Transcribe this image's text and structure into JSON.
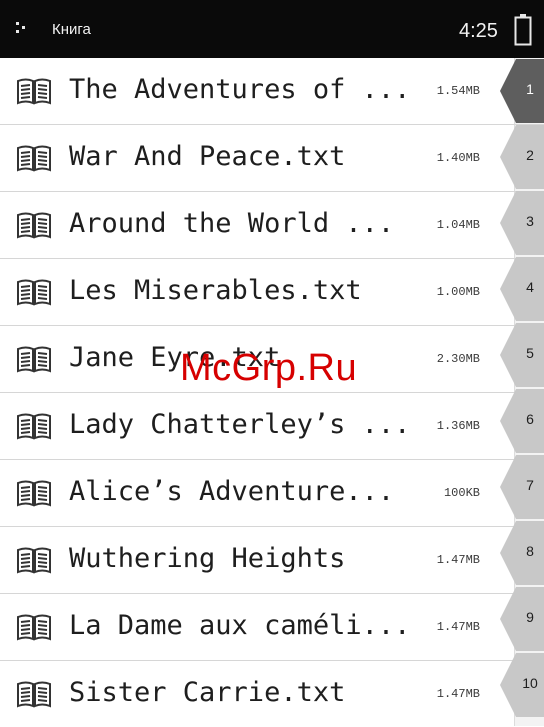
{
  "status_bar": {
    "app_title": "Книга",
    "time": "4:25",
    "menu_icon": "menu-dots-icon",
    "battery_icon": "battery-icon"
  },
  "books": [
    {
      "title": "The Adventures of ...",
      "size": "1.54MB",
      "page_tab": "1"
    },
    {
      "title": "War And Peace.txt",
      "size": "1.40MB",
      "page_tab": "2"
    },
    {
      "title": "Around the World ...",
      "size": "1.04MB",
      "page_tab": "3"
    },
    {
      "title": "Les Miserables.txt",
      "size": "1.00MB",
      "page_tab": "4"
    },
    {
      "title": "Jane Eyre.txt",
      "size": "2.30MB",
      "page_tab": "5"
    },
    {
      "title": "Lady Chatterley’s ...",
      "size": "1.36MB",
      "page_tab": "6"
    },
    {
      "title": "Alice’s Adventure...",
      "size": "100KB",
      "page_tab": "7"
    },
    {
      "title": "Wuthering Heights",
      "size": "1.47MB",
      "page_tab": "8"
    },
    {
      "title": "La Dame aux caméli...",
      "size": "1.47MB",
      "page_tab": "9"
    },
    {
      "title": "Sister Carrie.txt",
      "size": "1.47MB",
      "page_tab": "10"
    }
  ],
  "book_icon": "open-book-icon",
  "active_tab_index": 0,
  "watermark": "McGrp.Ru",
  "colors": {
    "status_bar_bg": "#0a0a0a",
    "active_tab": "#5e5e5e",
    "inactive_tab": "#c8c8c8"
  }
}
